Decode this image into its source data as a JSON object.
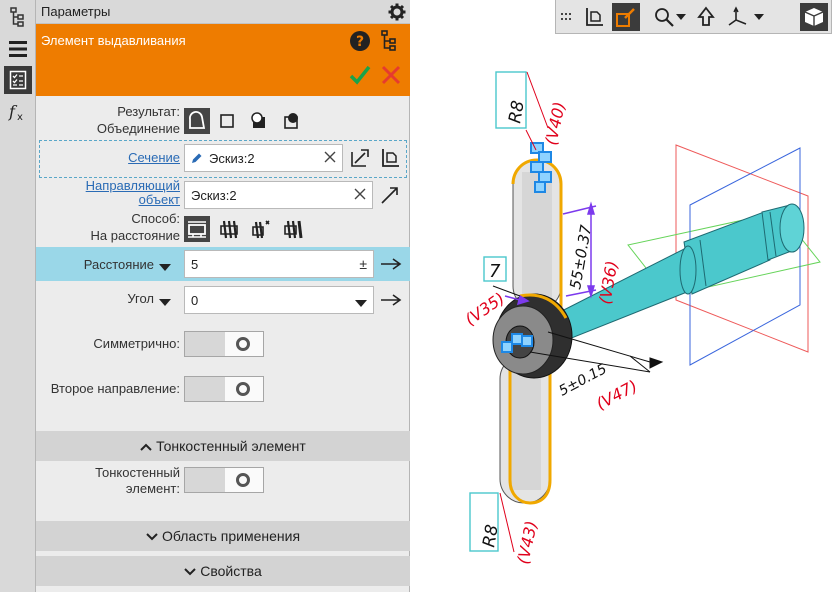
{
  "panel": {
    "title": "Параметры"
  },
  "operation": {
    "title": "Элемент выдавливания"
  },
  "result": {
    "label": "Результат:",
    "value": "Объединение"
  },
  "section_row": {
    "label": "Сечение",
    "value": "Эскиз:2"
  },
  "guide_row": {
    "label_line1": "Направляющий",
    "label_line2": "объект",
    "value": "Эскиз:2"
  },
  "method": {
    "label": "Способ:",
    "value": "На расстояние"
  },
  "distance": {
    "label": "Расстояние",
    "value": "5",
    "pm": "±"
  },
  "angle": {
    "label": "Угол",
    "value": "0"
  },
  "symmetric": {
    "label": "Симметрично:"
  },
  "second_direction": {
    "label": "Второе направление:"
  },
  "thin_section": {
    "title": "Тонкостенный элемент",
    "label_line1": "Тонкостенный",
    "label_line2": "элемент:"
  },
  "scope_section": {
    "title": "Область применения"
  },
  "props_section": {
    "title": "Свойства"
  },
  "model": {
    "dim_r8_top": "R8",
    "dim_v40": "(V40)",
    "dim_v36": "(V36)",
    "dim_v35": "(V35)",
    "dim_v47": "(V47)",
    "dim_v43": "(V43)",
    "dim_r8_bottom": "R8",
    "dim_7": "7",
    "dim_tol1": "55±0.37",
    "dim_tol2": "5±0.15"
  },
  "colors": {
    "accent": "#ee7c00",
    "highlight": "#9ad7e8",
    "link": "#2a6bb5",
    "dimension": "#e0001b",
    "part": "#4bc8cc"
  }
}
